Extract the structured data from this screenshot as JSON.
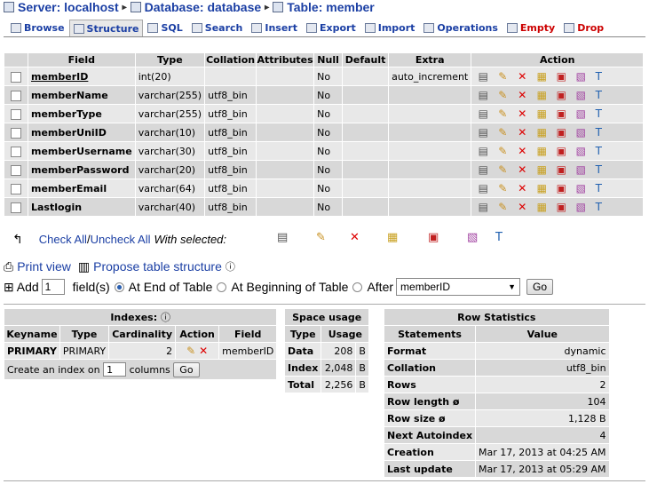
{
  "breadcrumb": {
    "server_label": "Server: localhost",
    "database_label": "Database: database",
    "table_label": "Table: member"
  },
  "tabs": [
    {
      "label": "Browse"
    },
    {
      "label": "Structure"
    },
    {
      "label": "SQL"
    },
    {
      "label": "Search"
    },
    {
      "label": "Insert"
    },
    {
      "label": "Export"
    },
    {
      "label": "Import"
    },
    {
      "label": "Operations"
    },
    {
      "label": "Empty"
    },
    {
      "label": "Drop"
    }
  ],
  "structure": {
    "headers": {
      "field": "Field",
      "type": "Type",
      "collation": "Collation",
      "attributes": "Attributes",
      "null": "Null",
      "default": "Default",
      "extra": "Extra",
      "action": "Action"
    },
    "rows": [
      {
        "field": "memberID",
        "type": "int(20)",
        "collation": "",
        "null": "No",
        "extra": "auto_increment",
        "primary": true
      },
      {
        "field": "memberName",
        "type": "varchar(255)",
        "collation": "utf8_bin",
        "null": "No",
        "extra": ""
      },
      {
        "field": "memberType",
        "type": "varchar(255)",
        "collation": "utf8_bin",
        "null": "No",
        "extra": ""
      },
      {
        "field": "memberUniID",
        "type": "varchar(10)",
        "collation": "utf8_bin",
        "null": "No",
        "extra": ""
      },
      {
        "field": "memberUsername",
        "type": "varchar(30)",
        "collation": "utf8_bin",
        "null": "No",
        "extra": ""
      },
      {
        "field": "memberPassword",
        "type": "varchar(20)",
        "collation": "utf8_bin",
        "null": "No",
        "extra": ""
      },
      {
        "field": "memberEmail",
        "type": "varchar(64)",
        "collation": "utf8_bin",
        "null": "No",
        "extra": ""
      },
      {
        "field": "Lastlogin",
        "type": "varchar(40)",
        "collation": "utf8_bin",
        "null": "No",
        "extra": ""
      }
    ]
  },
  "checkall": {
    "check_all": "Check All",
    "separator": " / ",
    "uncheck_all": "Uncheck All",
    "with_selected": "With selected:"
  },
  "links": {
    "print_view": "Print view",
    "propose": "Propose table structure"
  },
  "add_fields": {
    "add_label": "Add",
    "count": "1",
    "fields_label": "field(s)",
    "at_end": "At End of Table",
    "at_beginning": "At Beginning of Table",
    "after": "After",
    "after_field": "memberID",
    "go": "Go"
  },
  "indexes": {
    "title": "Indexes:",
    "headers": {
      "keyname": "Keyname",
      "type": "Type",
      "cardinality": "Cardinality",
      "action": "Action",
      "field": "Field"
    },
    "rows": [
      {
        "keyname": "PRIMARY",
        "type": "PRIMARY",
        "cardinality": "2",
        "field": "memberID"
      }
    ],
    "create_label": "Create an index on",
    "create_count": "1",
    "columns_label": "columns",
    "go": "Go"
  },
  "space_usage": {
    "title": "Space usage",
    "headers": {
      "type": "Type",
      "usage": "Usage"
    },
    "rows": [
      {
        "type": "Data",
        "value": "208",
        "unit": "B"
      },
      {
        "type": "Index",
        "value": "2,048",
        "unit": "B"
      },
      {
        "type": "Total",
        "value": "2,256",
        "unit": "B"
      }
    ]
  },
  "row_stats": {
    "title": "Row Statistics",
    "headers": {
      "statements": "Statements",
      "value": "Value"
    },
    "rows": [
      {
        "label": "Format",
        "value": "dynamic"
      },
      {
        "label": "Collation",
        "value": "utf8_bin"
      },
      {
        "label": "Rows",
        "value": "2"
      },
      {
        "label": "Row length ø",
        "value": "104"
      },
      {
        "label": "Row size ø",
        "value": "1,128 B"
      },
      {
        "label": "Next Autoindex",
        "value": "4"
      },
      {
        "label": "Creation",
        "value": "Mar 17, 2013 at 04:25 AM"
      },
      {
        "label": "Last update",
        "value": "Mar 17, 2013 at 05:29 AM"
      }
    ]
  },
  "colors": {
    "link": "#1b3fa4",
    "header_bg": "#d6d6d6",
    "row_odd": "#e8e8e8",
    "row_even": "#d8d8d8"
  }
}
